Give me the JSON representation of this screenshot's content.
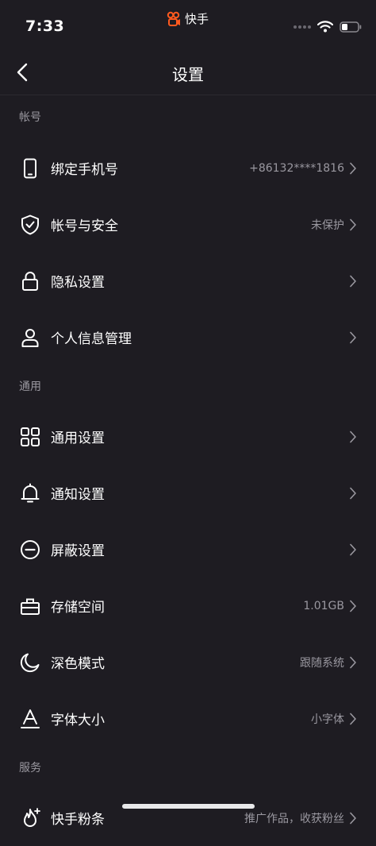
{
  "status": {
    "time": "7:33",
    "app_name": "快手"
  },
  "nav": {
    "title": "设置",
    "back_icon": "chevron-left-icon"
  },
  "sections": [
    {
      "header": "帐号",
      "items": [
        {
          "label": "绑定手机号",
          "value": "+86132****1816",
          "icon": "phone-icon"
        },
        {
          "label": "帐号与安全",
          "value": "未保护",
          "icon": "shield-check-icon"
        },
        {
          "label": "隐私设置",
          "value": "",
          "icon": "lock-icon"
        },
        {
          "label": "个人信息管理",
          "value": "",
          "icon": "person-icon"
        }
      ]
    },
    {
      "header": "通用",
      "items": [
        {
          "label": "通用设置",
          "value": "",
          "icon": "grid-icon"
        },
        {
          "label": "通知设置",
          "value": "",
          "icon": "bell-icon"
        },
        {
          "label": "屏蔽设置",
          "value": "",
          "icon": "block-icon"
        },
        {
          "label": "存储空间",
          "value": "1.01GB",
          "icon": "toolbox-icon"
        },
        {
          "label": "深色模式",
          "value": "跟随系统",
          "icon": "moon-icon"
        },
        {
          "label": "字体大小",
          "value": "小字体",
          "icon": "font-size-icon"
        }
      ]
    },
    {
      "header": "服务",
      "items": [
        {
          "label": "快手粉条",
          "value": "推广作品，收获粉丝",
          "icon": "flame-icon"
        }
      ]
    }
  ],
  "colors": {
    "background": "#1e1c22",
    "secondary_text": "#9a98a0",
    "brand": "#ff5a1f"
  }
}
